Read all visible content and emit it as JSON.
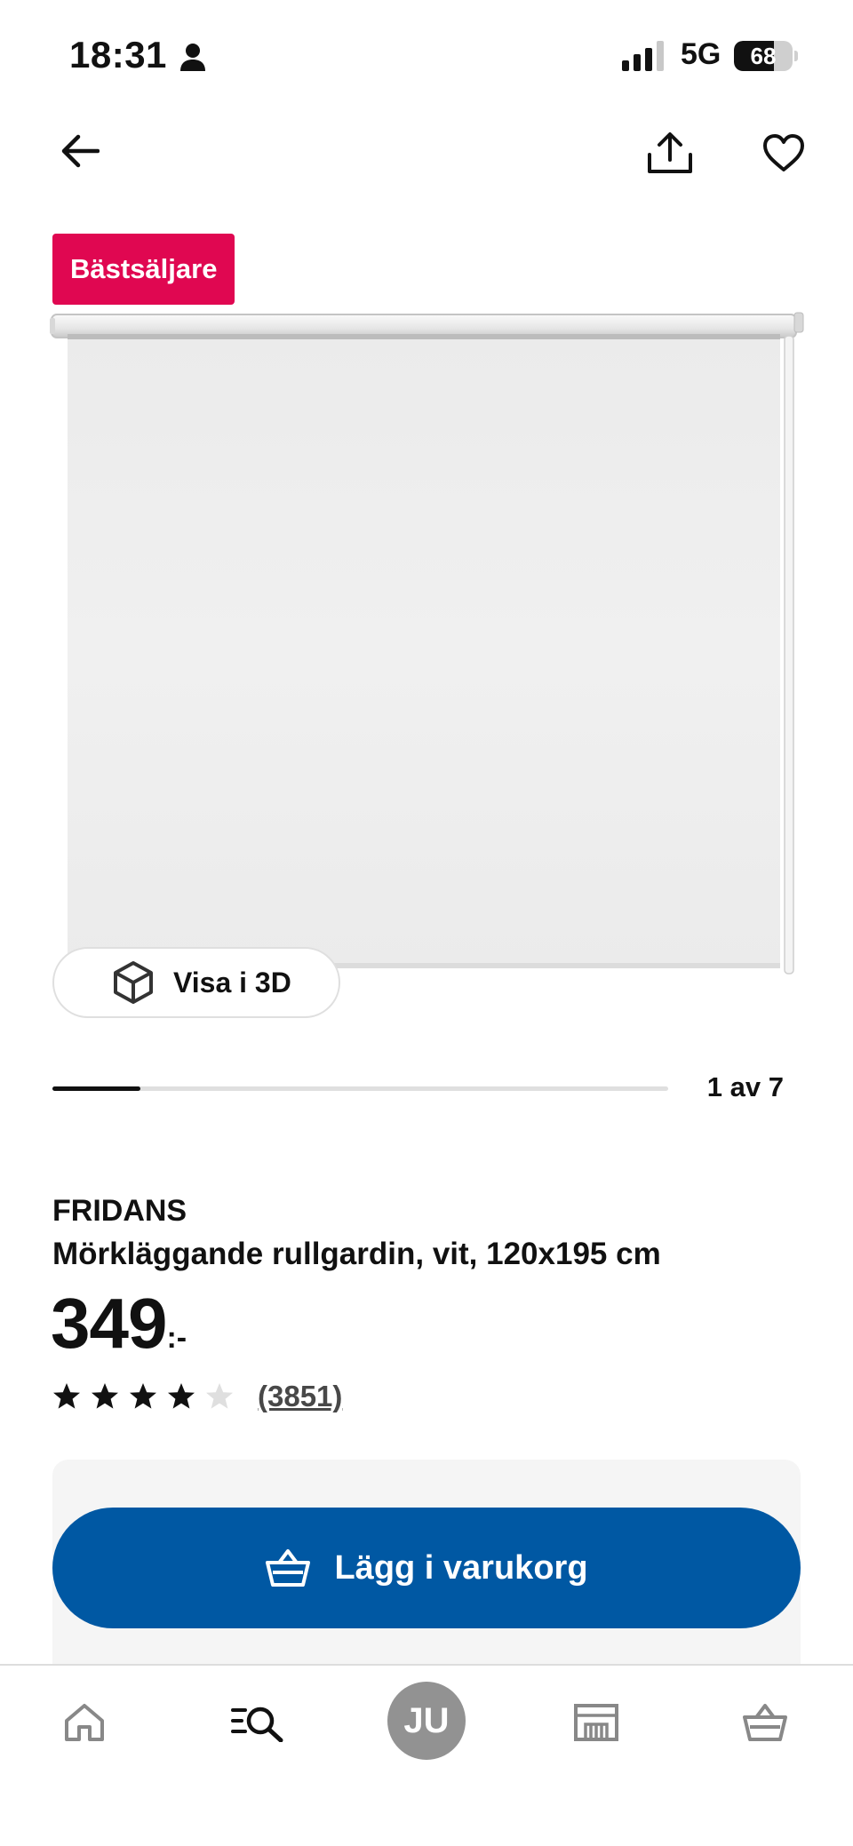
{
  "status_bar": {
    "time": "18:31",
    "network": "5G",
    "battery_label": "68",
    "battery_level_percent": 68,
    "icons": [
      "person-icon",
      "signal-icon",
      "battery-icon"
    ]
  },
  "header": {
    "icons": [
      "arrow-left-icon",
      "share-icon",
      "heart-icon"
    ]
  },
  "product": {
    "badge": "Bästsäljare",
    "badge_color": "#e00751",
    "view_3d_label": "Visa i 3D",
    "image_counter": "1 av 7",
    "carousel_current": 1,
    "carousel_total": 7,
    "brand": "FRIDANS",
    "description": "Mörkläggande rullgardin, vit, 120x195 cm",
    "price": "349",
    "price_suffix": ":-",
    "rating_stars": 4,
    "rating_max": 5,
    "review_count": "(3851)"
  },
  "cart": {
    "button_label": "Lägg i varukorg",
    "button_color": "#0058a3",
    "icon": "basket-icon"
  },
  "bottom_nav": {
    "profile_initials": "JU",
    "icons": [
      "home-icon",
      "search-icon",
      "avatar",
      "store-icon",
      "basket-icon"
    ]
  }
}
